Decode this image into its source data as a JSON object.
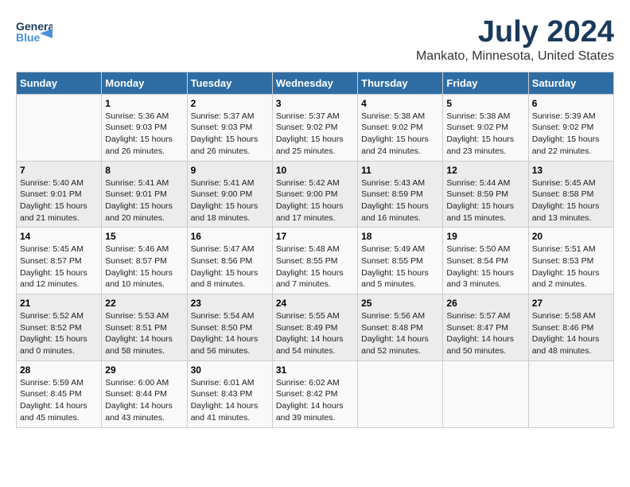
{
  "header": {
    "logo_line1": "General",
    "logo_line2": "Blue",
    "title": "July 2024",
    "subtitle": "Mankato, Minnesota, United States"
  },
  "columns": [
    "Sunday",
    "Monday",
    "Tuesday",
    "Wednesday",
    "Thursday",
    "Friday",
    "Saturday"
  ],
  "weeks": [
    [
      {
        "day": "",
        "info": ""
      },
      {
        "day": "1",
        "info": "Sunrise: 5:36 AM\nSunset: 9:03 PM\nDaylight: 15 hours and 26 minutes."
      },
      {
        "day": "2",
        "info": "Sunrise: 5:37 AM\nSunset: 9:03 PM\nDaylight: 15 hours and 26 minutes."
      },
      {
        "day": "3",
        "info": "Sunrise: 5:37 AM\nSunset: 9:02 PM\nDaylight: 15 hours and 25 minutes."
      },
      {
        "day": "4",
        "info": "Sunrise: 5:38 AM\nSunset: 9:02 PM\nDaylight: 15 hours and 24 minutes."
      },
      {
        "day": "5",
        "info": "Sunrise: 5:38 AM\nSunset: 9:02 PM\nDaylight: 15 hours and 23 minutes."
      },
      {
        "day": "6",
        "info": "Sunrise: 5:39 AM\nSunset: 9:02 PM\nDaylight: 15 hours and 22 minutes."
      }
    ],
    [
      {
        "day": "7",
        "info": "Sunrise: 5:40 AM\nSunset: 9:01 PM\nDaylight: 15 hours and 21 minutes."
      },
      {
        "day": "8",
        "info": "Sunrise: 5:41 AM\nSunset: 9:01 PM\nDaylight: 15 hours and 20 minutes."
      },
      {
        "day": "9",
        "info": "Sunrise: 5:41 AM\nSunset: 9:00 PM\nDaylight: 15 hours and 18 minutes."
      },
      {
        "day": "10",
        "info": "Sunrise: 5:42 AM\nSunset: 9:00 PM\nDaylight: 15 hours and 17 minutes."
      },
      {
        "day": "11",
        "info": "Sunrise: 5:43 AM\nSunset: 8:59 PM\nDaylight: 15 hours and 16 minutes."
      },
      {
        "day": "12",
        "info": "Sunrise: 5:44 AM\nSunset: 8:59 PM\nDaylight: 15 hours and 15 minutes."
      },
      {
        "day": "13",
        "info": "Sunrise: 5:45 AM\nSunset: 8:58 PM\nDaylight: 15 hours and 13 minutes."
      }
    ],
    [
      {
        "day": "14",
        "info": "Sunrise: 5:45 AM\nSunset: 8:57 PM\nDaylight: 15 hours and 12 minutes."
      },
      {
        "day": "15",
        "info": "Sunrise: 5:46 AM\nSunset: 8:57 PM\nDaylight: 15 hours and 10 minutes."
      },
      {
        "day": "16",
        "info": "Sunrise: 5:47 AM\nSunset: 8:56 PM\nDaylight: 15 hours and 8 minutes."
      },
      {
        "day": "17",
        "info": "Sunrise: 5:48 AM\nSunset: 8:55 PM\nDaylight: 15 hours and 7 minutes."
      },
      {
        "day": "18",
        "info": "Sunrise: 5:49 AM\nSunset: 8:55 PM\nDaylight: 15 hours and 5 minutes."
      },
      {
        "day": "19",
        "info": "Sunrise: 5:50 AM\nSunset: 8:54 PM\nDaylight: 15 hours and 3 minutes."
      },
      {
        "day": "20",
        "info": "Sunrise: 5:51 AM\nSunset: 8:53 PM\nDaylight: 15 hours and 2 minutes."
      }
    ],
    [
      {
        "day": "21",
        "info": "Sunrise: 5:52 AM\nSunset: 8:52 PM\nDaylight: 15 hours and 0 minutes."
      },
      {
        "day": "22",
        "info": "Sunrise: 5:53 AM\nSunset: 8:51 PM\nDaylight: 14 hours and 58 minutes."
      },
      {
        "day": "23",
        "info": "Sunrise: 5:54 AM\nSunset: 8:50 PM\nDaylight: 14 hours and 56 minutes."
      },
      {
        "day": "24",
        "info": "Sunrise: 5:55 AM\nSunset: 8:49 PM\nDaylight: 14 hours and 54 minutes."
      },
      {
        "day": "25",
        "info": "Sunrise: 5:56 AM\nSunset: 8:48 PM\nDaylight: 14 hours and 52 minutes."
      },
      {
        "day": "26",
        "info": "Sunrise: 5:57 AM\nSunset: 8:47 PM\nDaylight: 14 hours and 50 minutes."
      },
      {
        "day": "27",
        "info": "Sunrise: 5:58 AM\nSunset: 8:46 PM\nDaylight: 14 hours and 48 minutes."
      }
    ],
    [
      {
        "day": "28",
        "info": "Sunrise: 5:59 AM\nSunset: 8:45 PM\nDaylight: 14 hours and 45 minutes."
      },
      {
        "day": "29",
        "info": "Sunrise: 6:00 AM\nSunset: 8:44 PM\nDaylight: 14 hours and 43 minutes."
      },
      {
        "day": "30",
        "info": "Sunrise: 6:01 AM\nSunset: 8:43 PM\nDaylight: 14 hours and 41 minutes."
      },
      {
        "day": "31",
        "info": "Sunrise: 6:02 AM\nSunset: 8:42 PM\nDaylight: 14 hours and 39 minutes."
      },
      {
        "day": "",
        "info": ""
      },
      {
        "day": "",
        "info": ""
      },
      {
        "day": "",
        "info": ""
      }
    ]
  ]
}
